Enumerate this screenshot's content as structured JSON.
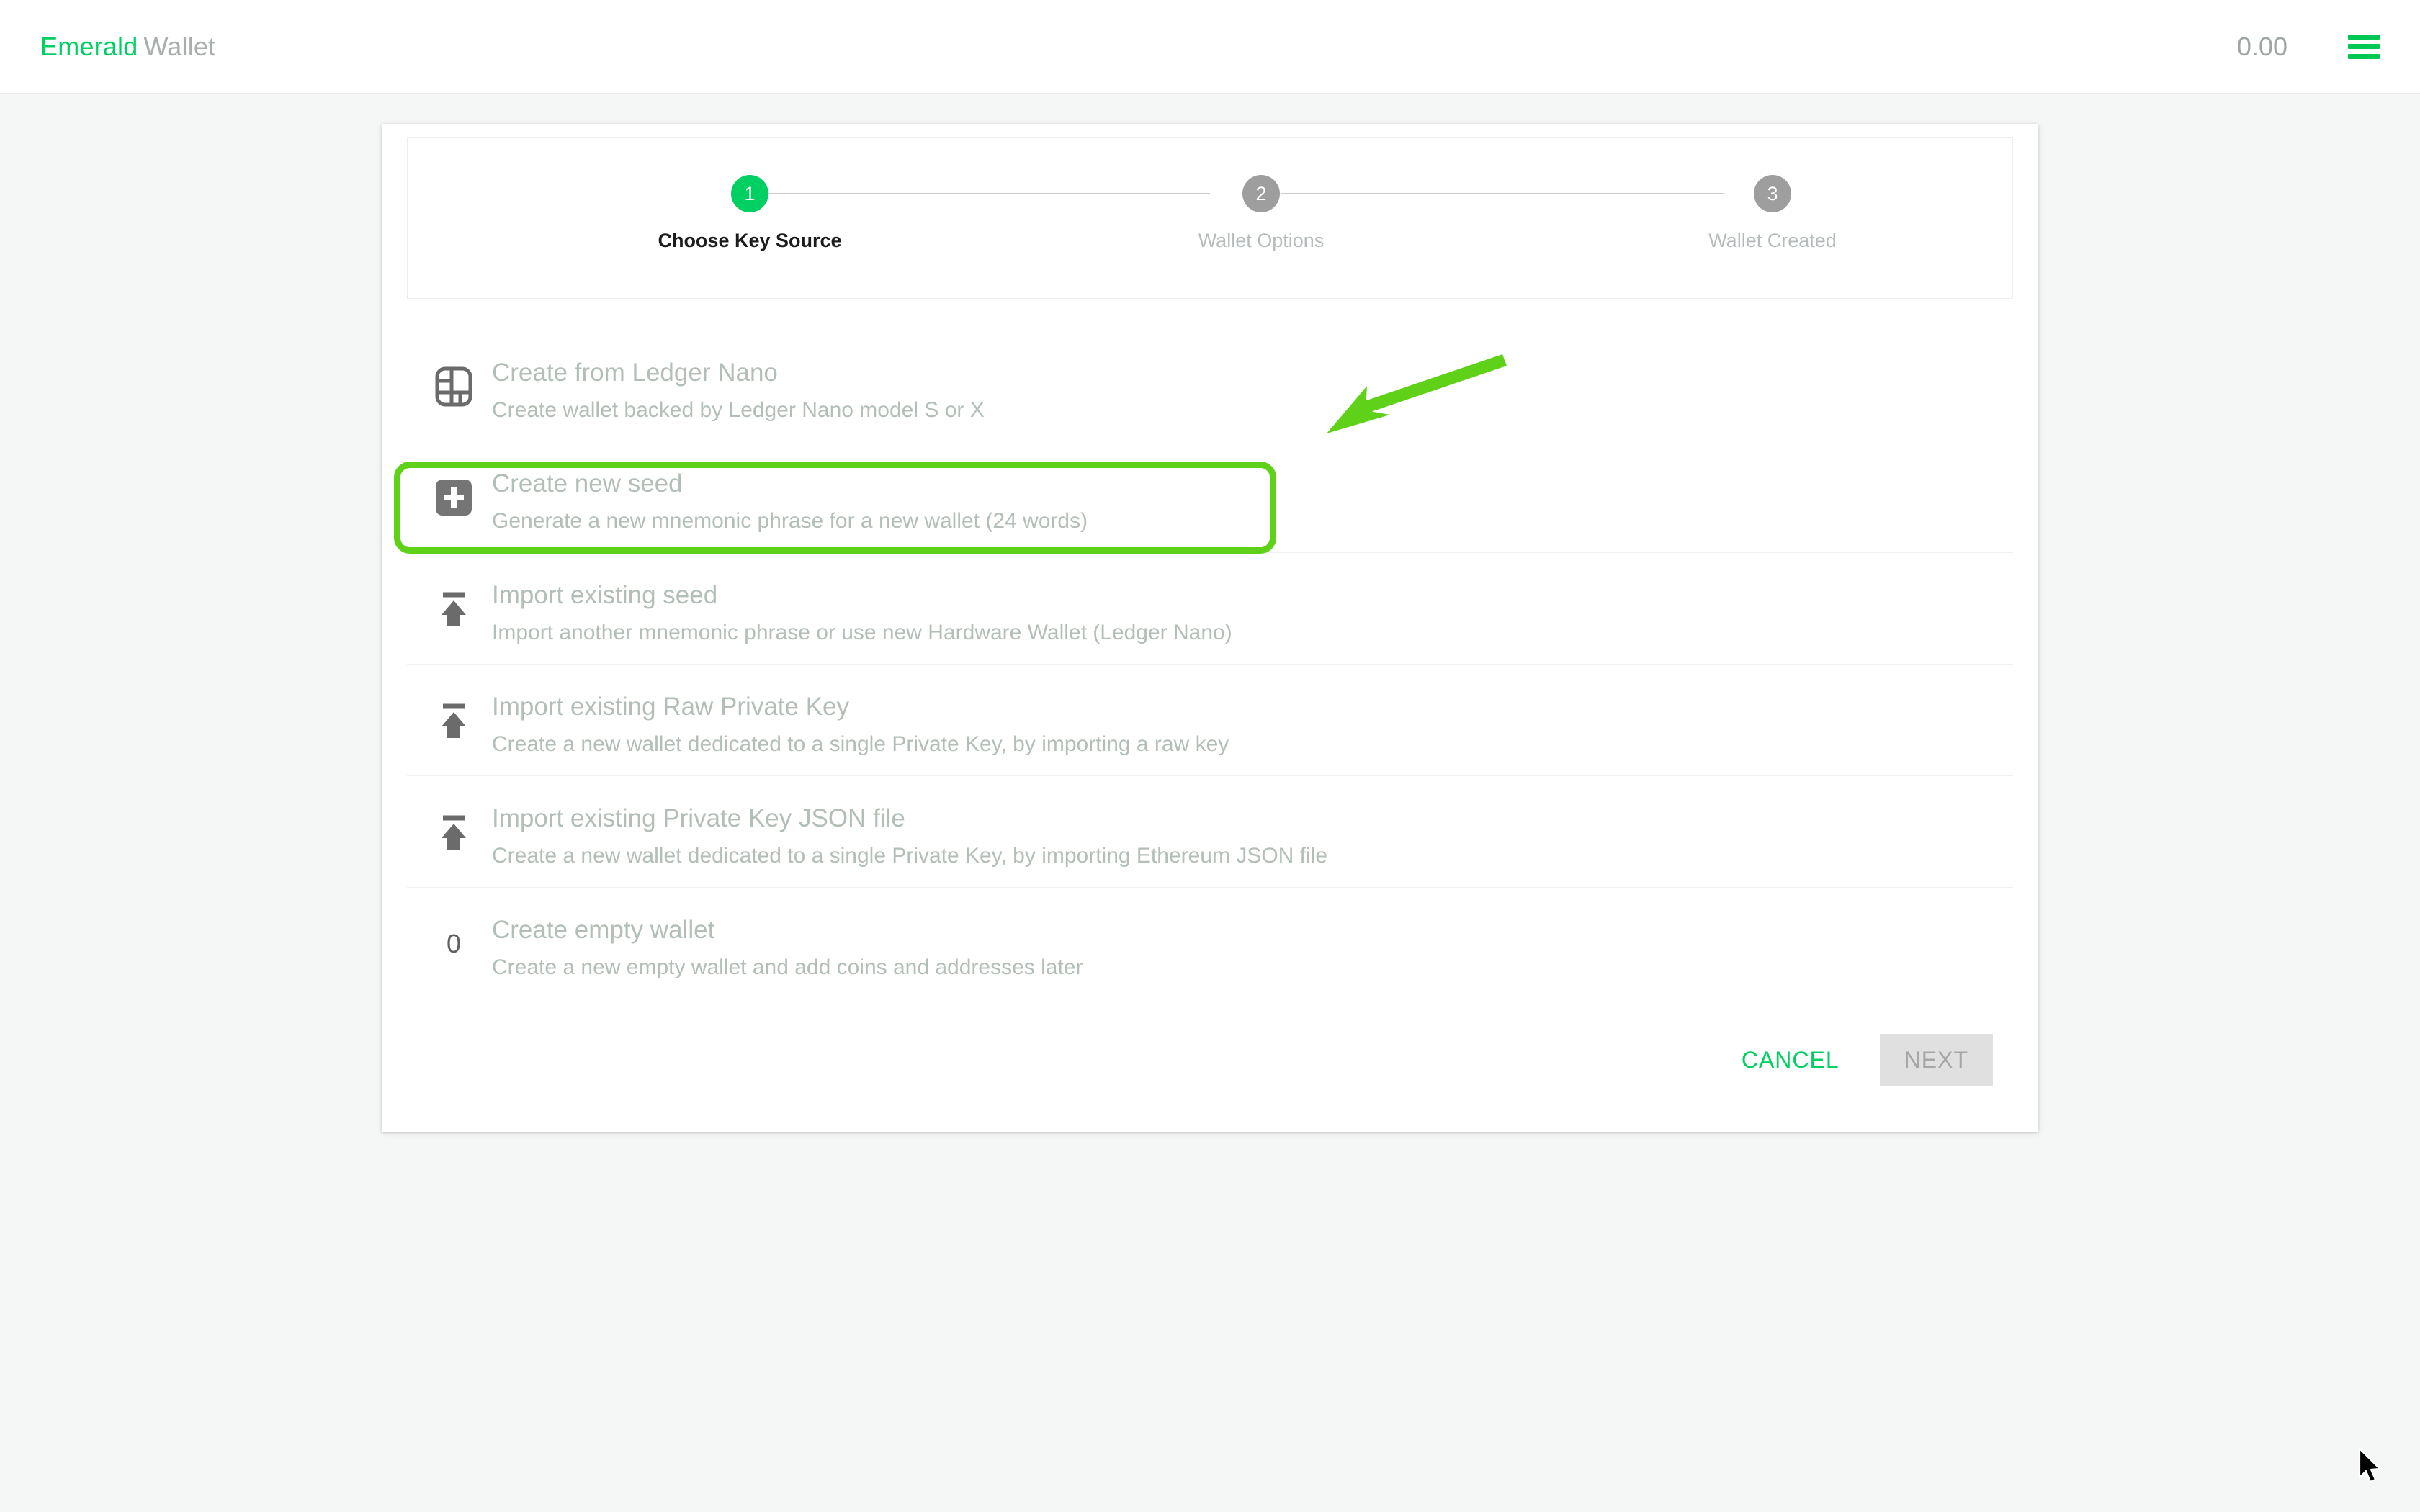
{
  "topbar": {
    "brand_primary": "Emerald",
    "brand_secondary": "Wallet",
    "balance": "0.00",
    "menu_icon": "hamburger-menu-icon"
  },
  "stepper": {
    "steps": [
      {
        "number": "1",
        "label": "Choose Key Source",
        "state": "active"
      },
      {
        "number": "2",
        "label": "Wallet Options",
        "state": "inactive"
      },
      {
        "number": "3",
        "label": "Wallet Created",
        "state": "inactive"
      }
    ]
  },
  "options": [
    {
      "icon": "ledger-device-icon",
      "title": "Create from Ledger Nano",
      "desc": "Create wallet backed by Ledger Nano model S or X",
      "highlighted": false
    },
    {
      "icon": "plus-square-icon",
      "title": "Create new seed",
      "desc": "Generate a new mnemonic phrase for a new wallet (24 words)",
      "highlighted": true
    },
    {
      "icon": "upload-arrow-icon",
      "title": "Import existing seed",
      "desc": "Import another mnemonic phrase or use new Hardware Wallet (Ledger Nano)",
      "highlighted": false
    },
    {
      "icon": "upload-arrow-icon",
      "title": "Import existing Raw Private Key",
      "desc": "Create a new wallet dedicated to a single Private Key, by importing a raw key",
      "highlighted": false
    },
    {
      "icon": "upload-arrow-icon",
      "title": "Import existing Private Key JSON file",
      "desc": "Create a new wallet dedicated to a single Private Key, by importing Ethereum JSON file",
      "highlighted": false
    },
    {
      "icon": "zero-digit-icon",
      "title": "Create empty wallet",
      "desc": "Create a new empty wallet and add coins and addresses later",
      "highlighted": false
    }
  ],
  "footer": {
    "cancel_label": "CANCEL",
    "next_label": "NEXT"
  },
  "annotation": {
    "highlight_color": "#5fd118",
    "arrow_color": "#5fd118",
    "target": "Create new seed"
  },
  "colors": {
    "accent_green": "#00d061",
    "page_background": "#f5f6f6",
    "card_background": "#ffffff",
    "muted_text": "#b2bfb6"
  }
}
